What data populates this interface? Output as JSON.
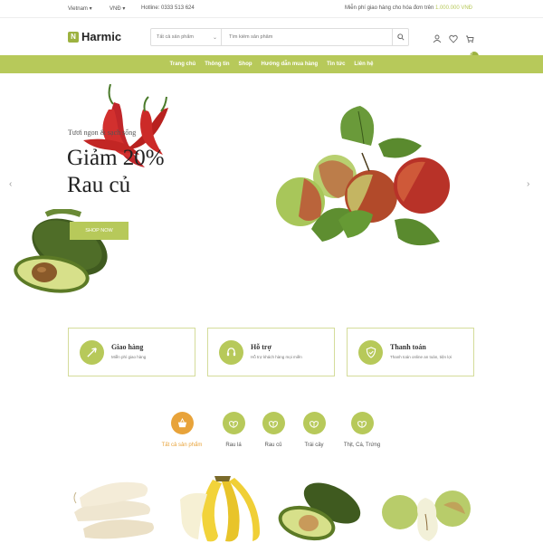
{
  "topbar": {
    "language": "Vietnam ▾",
    "currency": "VNĐ ▾",
    "hotline": "Hotline: 0333 513 624",
    "shipping_text": "Miễn phí giao hàng cho hóa đơn trên ",
    "shipping_amount": "1.000.000 VNĐ"
  },
  "header": {
    "logo_text": "Harmic",
    "search_category": "Tất cả sản phẩm",
    "search_placeholder": "Tìm kiếm sản phẩm",
    "cart_count": "0"
  },
  "nav": {
    "items": [
      "Trang chủ",
      "Thông tin",
      "Shop",
      "Hướng dẫn mua hàng",
      "Tin tức",
      "Liên hệ"
    ]
  },
  "hero": {
    "subtitle": "Tươi ngon & sạch sống",
    "title_line1": "Giảm 20%",
    "title_line2": "Rau củ",
    "button": "SHOP NOW"
  },
  "features": [
    {
      "title": "Giao hàng",
      "desc": "Miễn phí giao hàng"
    },
    {
      "title": "Hỗ trợ",
      "desc": "Hỗ trợ khách hàng mọi miền"
    },
    {
      "title": "Thanh toán",
      "desc": "Thanh toán online an toàn, tiện lợi"
    }
  ],
  "categories": [
    {
      "label": "Tất cả sản phẩm",
      "active": true
    },
    {
      "label": "Rau lá",
      "active": false
    },
    {
      "label": "Rau củ",
      "active": false
    },
    {
      "label": "Trái cây",
      "active": false
    },
    {
      "label": "Thịt, Cá, Trứng",
      "active": false
    }
  ],
  "colors": {
    "accent": "#b7c95a",
    "accent_dark": "#9db240",
    "active_category": "#e8a33a"
  }
}
